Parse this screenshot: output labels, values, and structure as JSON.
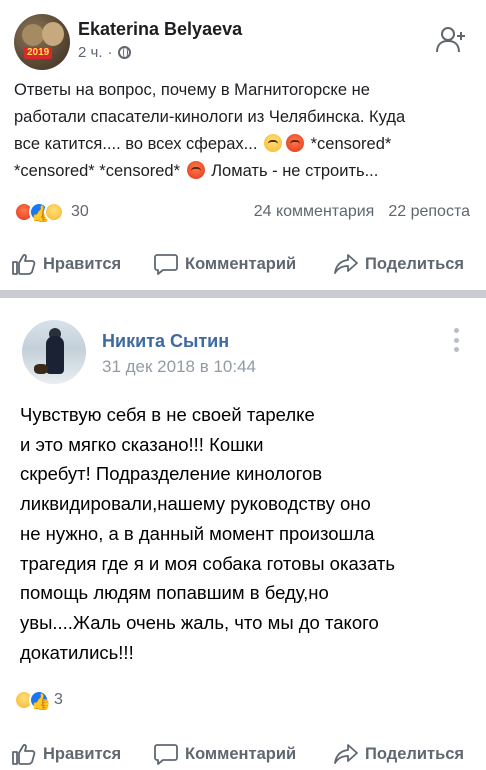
{
  "post1": {
    "author": "Ekaterina Belyaeva",
    "time": "2 ч.",
    "separator": "·",
    "text_line1": "Ответы на вопрос, почему в Магнитогорске не",
    "text_line2": "работали спасатели-кинологи из Челябинска. Куда",
    "text_line3a": "все катится.... во всех сферах...",
    "text_line3b": "*censored*",
    "text_line4a": "*censored* *censored*",
    "text_line4b": "Ломать - не строить...",
    "avatar_badge": "2019",
    "reaction_count": "30",
    "comments": "24 комментария",
    "shares": "22 репоста",
    "icons": [
      "avatar",
      "globe-icon",
      "add-friend-icon",
      "angry-emoji",
      "sneeze-emoji"
    ]
  },
  "actions": {
    "like": "Нравится",
    "comment": "Комментарий",
    "share": "Поделиться"
  },
  "post2": {
    "author": "Никита Сытин",
    "date": "31 дек 2018 в 10:44",
    "text_lines": [
      "Чувствую себя в не своей тарелке",
      "и это мягко сказано!!! Кошки",
      "скребут! Подразделение кинологов",
      "ликвидировали,нашему руководству оно",
      "не нужно, а в данный момент произошла",
      "трагедия где я и моя собака готовы оказать",
      "помощь людям попавшим в беду,но",
      "увы....Жаль очень жаль, что мы до такого",
      "докатились!!!"
    ],
    "reaction_count": "3"
  },
  "colors": {
    "vk_name": "#3d6aa0",
    "fb_like": "#1877f2",
    "muted": "#606770",
    "divider": "#c9ccd1"
  }
}
